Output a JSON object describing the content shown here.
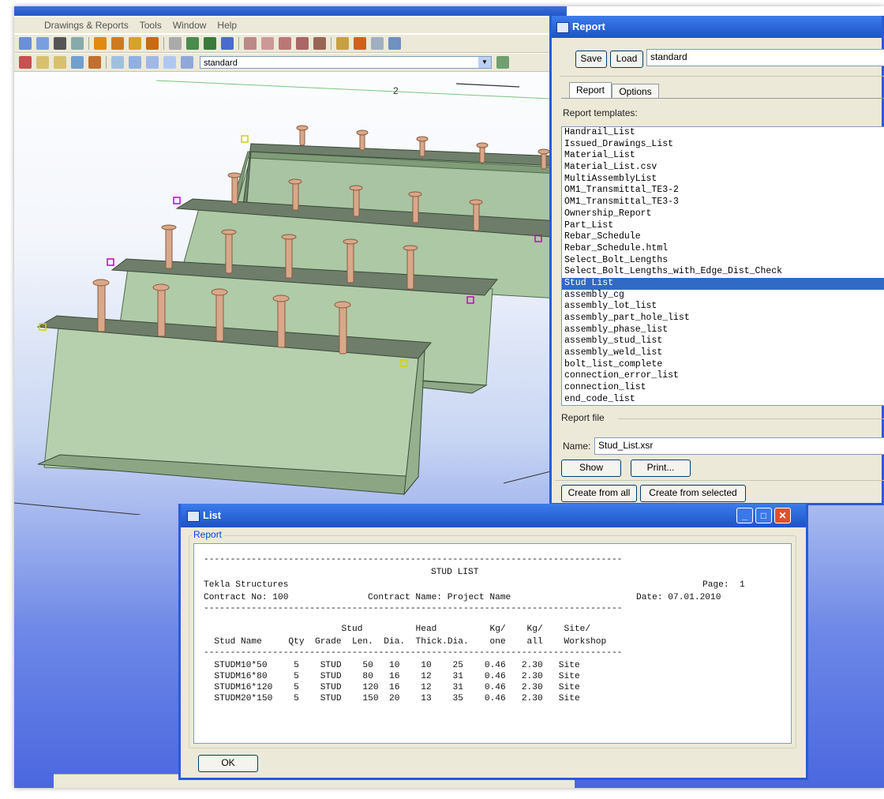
{
  "app": {
    "menu": [
      "Drawings & Reports",
      "Tools",
      "Window",
      "Help"
    ],
    "toolbar_combo": "standard",
    "grid_label": "2"
  },
  "report_dialog": {
    "title": "Report",
    "save_label": "Save",
    "load_label": "Load",
    "settings_value": "standard",
    "tabs": [
      "Report",
      "Options"
    ],
    "templates_label": "Report templates:",
    "templates": [
      "Handrail_List",
      "Issued_Drawings_List",
      "Material_List",
      "Material_List.csv",
      "MultiAssemblyList",
      "OM1_Transmittal_TE3-2",
      "OM1_Transmittal_TE3-3",
      "Ownership_Report",
      "Part_List",
      "Rebar_Schedule",
      "Rebar_Schedule.html",
      "Select_Bolt_Lengths",
      "Select_Bolt_Lengths_with_Edge_Dist_Check",
      "Stud List",
      "assembly_cg",
      "assembly_lot_list",
      "assembly_part_hole_list",
      "assembly_phase_list",
      "assembly_stud_list",
      "assembly_weld_list",
      "bolt_list_complete",
      "connection_error_list",
      "connection_list",
      "end_code_list"
    ],
    "selected_template": "Stud List",
    "report_file_label": "Report file",
    "name_label": "Name:",
    "name_value": "Stud_List.xsr",
    "show_label": "Show",
    "print_label": "Print...",
    "create_all_label": "Create from all",
    "create_selected_label": "Create from selected"
  },
  "list_window": {
    "title": "List",
    "group_label": "Report",
    "ok_label": "OK",
    "report_title": "STUD LIST",
    "company": "Tekla Structures",
    "page": "Page:  1",
    "contract_no": "Contract No: 100",
    "contract_name": "Contract Name: Project Name",
    "date": "Date: 07.01.2010",
    "header_line1": "                          Stud          Head          Kg/    Kg/    Site/",
    "header_line2": "  Stud Name     Qty  Grade  Len.  Dia.  Thick.Dia.    one    all    Workshop",
    "rows": [
      "  STUDM10*50     5    STUD    50   10    10    25    0.46   2.30   Site",
      "  STUDM16*80     5    STUD    80   16    12    31    0.46   2.30   Site",
      "  STUDM16*120    5    STUD    120  16    12    31    0.46   2.30   Site",
      "  STUDM20*150    5    STUD    150  20    13    35    0.46   2.30   Site"
    ],
    "dashes": "-------------------------------------------------------------------------------"
  }
}
